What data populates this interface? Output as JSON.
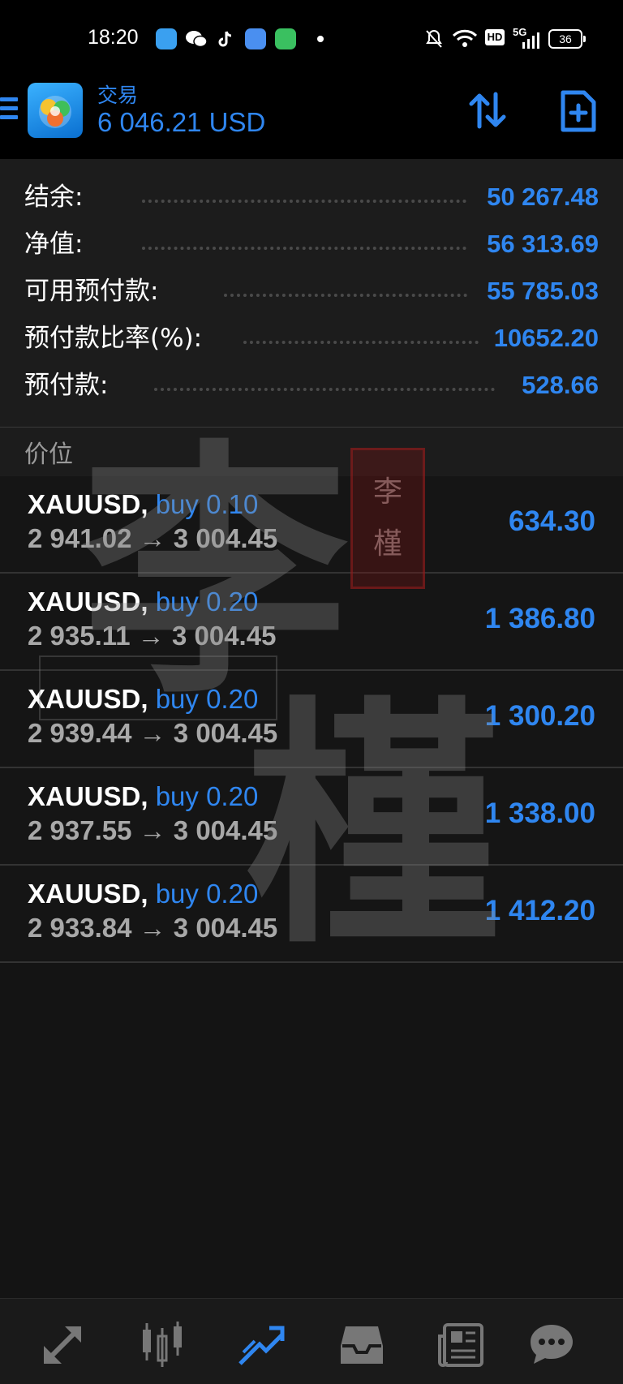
{
  "status_bar": {
    "time": "18:20",
    "battery": "36",
    "network": "5G",
    "hd": "HD",
    "icons": [
      "app-icon",
      "wechat-icon",
      "tiktok-icon",
      "app-icon",
      "shop-icon",
      "mute-icon",
      "wifi-icon",
      "signal-icon",
      "battery-icon"
    ]
  },
  "header": {
    "title": "交易",
    "balance": "6 046.21 USD",
    "icons": [
      "menu-icon",
      "app-logo",
      "sort-icon",
      "new-order-icon"
    ],
    "accent": "#2f86f0"
  },
  "summary": [
    {
      "label": "结余:",
      "value": "50 267.48"
    },
    {
      "label": "净值:",
      "value": "56 313.69"
    },
    {
      "label": "可用预付款:",
      "value": "55 785.03"
    },
    {
      "label": "预付款比率(%):",
      "value": "10652.20"
    },
    {
      "label": "预付款:",
      "value": "528.66"
    }
  ],
  "positions_title": "价位",
  "positions": [
    {
      "symbol": "XAUUSD,",
      "side": "buy 0.10",
      "prices": "2 941.02 → 3 004.45",
      "profit": "634.30"
    },
    {
      "symbol": "XAUUSD,",
      "side": "buy 0.20",
      "prices": "2 935.11 → 3 004.45",
      "profit": "1 386.80"
    },
    {
      "symbol": "XAUUSD,",
      "side": "buy 0.20",
      "prices": "2 939.44 → 3 004.45",
      "profit": "1 300.20"
    },
    {
      "symbol": "XAUUSD,",
      "side": "buy 0.20",
      "prices": "2 937.55 → 3 004.45",
      "profit": "1 338.00"
    },
    {
      "symbol": "XAUUSD,",
      "side": "buy 0.20",
      "prices": "2 933.84 → 3 004.45",
      "profit": "1 412.20"
    }
  ],
  "watermark": {
    "large_1": "李",
    "large_2": "槿",
    "seal_1": "李",
    "seal_2": "槿"
  },
  "bottom_nav": [
    "quotes-icon",
    "chart-icon",
    "trade-icon",
    "history-icon",
    "news-icon",
    "chat-icon"
  ]
}
